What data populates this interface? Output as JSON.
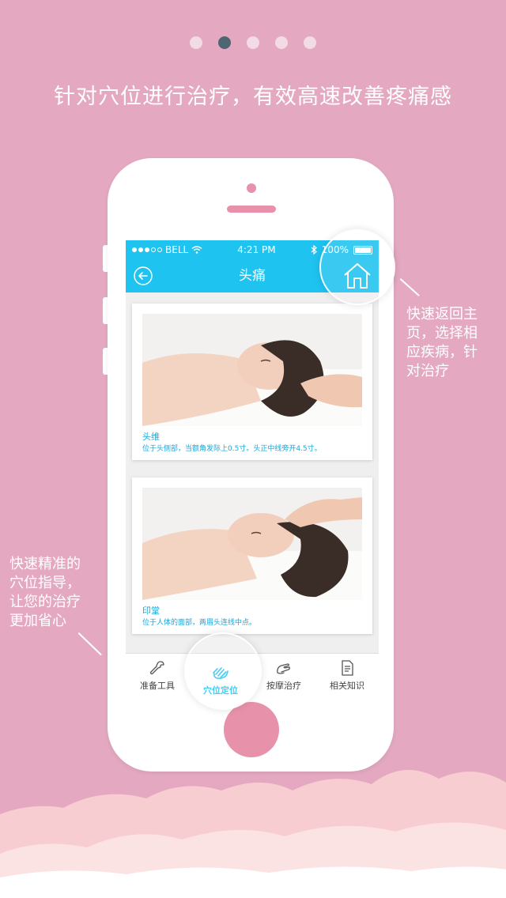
{
  "pagination": {
    "total": 5,
    "active_index": 1
  },
  "headline": "针对穴位进行治疗，有效高速改善疼痛感",
  "status_bar": {
    "carrier": "BELL",
    "time": "4:21 PM",
    "battery": "100%"
  },
  "nav": {
    "title": "头痛"
  },
  "cards": [
    {
      "name": "头维",
      "desc": "位于头侧部，当额角发际上0.5寸。头正中线旁开4.5寸。"
    },
    {
      "name": "印堂",
      "desc": "位于人体的面部，两眉头连线中点。"
    }
  ],
  "tabs": [
    {
      "label": "准备工具",
      "icon": "wrench-icon"
    },
    {
      "label": "穴位定位",
      "icon": "hand-icon"
    },
    {
      "label": "按摩治疗",
      "icon": "massage-hand-icon"
    },
    {
      "label": "相关知识",
      "icon": "document-icon"
    }
  ],
  "callouts": {
    "right": "快速返回主\n页，选择相\n应疾病，针\n对治疗",
    "left": "快速精准的\n穴位指导，\n让您的治疗\n更加省心"
  },
  "colors": {
    "background": "#e4a9c1",
    "accent": "#1fc3f0",
    "phone_key": "#e891ab"
  }
}
